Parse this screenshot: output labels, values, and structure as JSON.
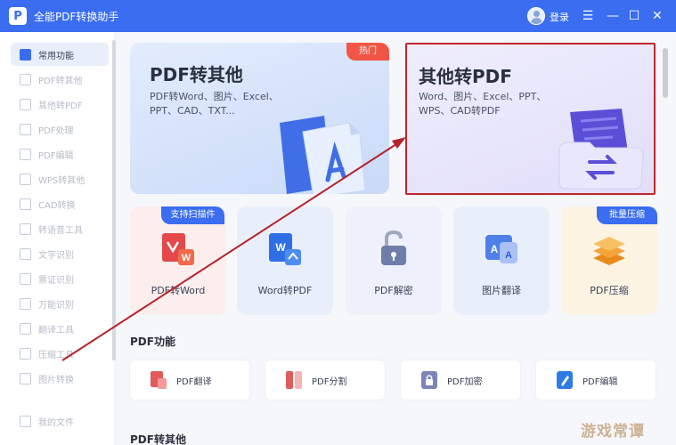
{
  "window": {
    "title": "全能PDF转换助手",
    "logo_letter": "P",
    "login_label": "登录"
  },
  "sidebar": {
    "items": [
      {
        "label": "常用功能"
      },
      {
        "label": "PDF转其他"
      },
      {
        "label": "其他转PDF"
      },
      {
        "label": "PDF处理"
      },
      {
        "label": "PDF编辑"
      },
      {
        "label": "WPS转其他"
      },
      {
        "label": "CAD转换"
      },
      {
        "label": "转语音工具"
      },
      {
        "label": "文字识别"
      },
      {
        "label": "票证识别"
      },
      {
        "label": "万能识别"
      },
      {
        "label": "翻译工具"
      },
      {
        "label": "压缩工具"
      },
      {
        "label": "图片转换"
      }
    ],
    "bottom_item": "我的文件"
  },
  "main": {
    "card_pdf_to_other": {
      "title": "PDF转其他",
      "desc_line1": "PDF转Word、图片、Excel、",
      "desc_line2": "PPT、CAD、TXT...",
      "badge": "热门"
    },
    "card_other_to_pdf": {
      "title": "其他转PDF",
      "desc_line1": "Word、图片、Excel、PPT、",
      "desc_line2": "WPS、CAD转PDF"
    },
    "tools": [
      {
        "label": "PDF转Word",
        "tag": "支持扫描件"
      },
      {
        "label": "Word转PDF"
      },
      {
        "label": "PDF解密"
      },
      {
        "label": "图片翻译"
      },
      {
        "label": "PDF压缩",
        "tag": "批量压缩"
      }
    ],
    "section_pdf_functions": "PDF功能",
    "functions": [
      {
        "label": "PDF翻译"
      },
      {
        "label": "PDF分割"
      },
      {
        "label": "PDF加密"
      },
      {
        "label": "PDF编辑"
      }
    ],
    "section_pdf_to_other": "PDF转其他"
  },
  "watermark": "游戏常谭",
  "colors": {
    "accent": "#3a6df0",
    "highlight_border": "#c0272d",
    "hot_badge": "#f25545",
    "arrow": "#b5232b"
  }
}
